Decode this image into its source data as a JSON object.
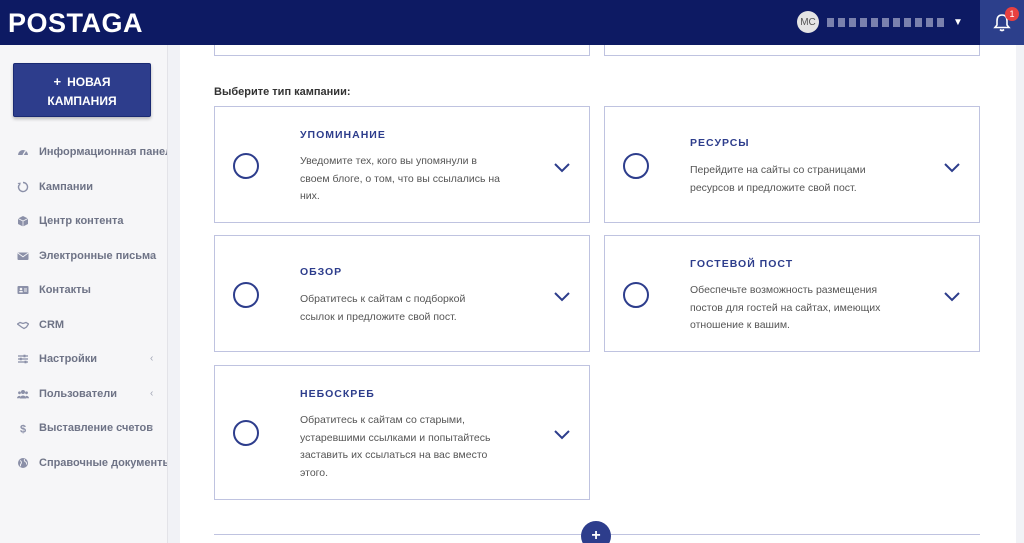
{
  "header": {
    "logo": "POSTAGA",
    "user_initials": "MC",
    "notification_count": "1",
    "icons": {
      "caret": "caret-down-icon",
      "bell": "bell-icon"
    }
  },
  "sidebar": {
    "new_campaign": {
      "plus": "+",
      "line1": "НОВАЯ",
      "line2": "КАМПАНИЯ"
    },
    "items": [
      {
        "label": "Информационная панель",
        "icon": "dashboard-icon",
        "chevron": false
      },
      {
        "label": "Кампании",
        "icon": "campaigns-icon",
        "chevron": false
      },
      {
        "label": "Центр контента",
        "icon": "box-icon",
        "chevron": false
      },
      {
        "label": "Электронные письма",
        "icon": "envelope-icon",
        "chevron": true
      },
      {
        "label": "Контакты",
        "icon": "contact-card-icon",
        "chevron": false
      },
      {
        "label": "CRM",
        "icon": "handshake-icon",
        "chevron": false
      },
      {
        "label": "Настройки",
        "icon": "sliders-icon",
        "chevron": true
      },
      {
        "label": "Пользователи",
        "icon": "users-icon",
        "chevron": true
      },
      {
        "label": "Выставление счетов",
        "icon": "dollar-icon",
        "chevron": true
      },
      {
        "label": "Справочные документы",
        "icon": "globe-icon",
        "chevron": false
      }
    ],
    "chevron_glyph": "‹"
  },
  "main": {
    "section_title": "Выберите тип кампании:",
    "cards": [
      {
        "title": "УПОМИНАНИЕ",
        "desc": [
          "Уведомите тех, кого вы упомянули в",
          "своем блоге, о том, что вы ссылались на",
          "них."
        ]
      },
      {
        "title": "РЕСУРСЫ",
        "desc": [
          "Перейдите на сайты со страницами",
          "ресурсов и предложите свой пост."
        ]
      },
      {
        "title": "ОБЗОР",
        "desc": [
          "Обратитесь к сайтам с подборкой",
          "ссылок и предложите свой пост."
        ]
      },
      {
        "title": "ГОСТЕВОЙ ПОСТ",
        "desc": [
          "Обеспечьте возможность размещения",
          "постов для гостей на сайтах, имеющих",
          "отношение к вашим."
        ]
      },
      {
        "title": "НЕБОСКРЕБ",
        "desc": [
          "Обратитесь к сайтам со старыми,",
          "устаревшими ссылками и попытайтесь",
          "заставить их ссылаться на вас вместо",
          "этого."
        ]
      }
    ],
    "add_button": "+"
  },
  "colors": {
    "header_bg": "#0d1a63",
    "accent": "#2d3d8c",
    "card_border": "#bfc3e0",
    "badge": "#e84040"
  }
}
